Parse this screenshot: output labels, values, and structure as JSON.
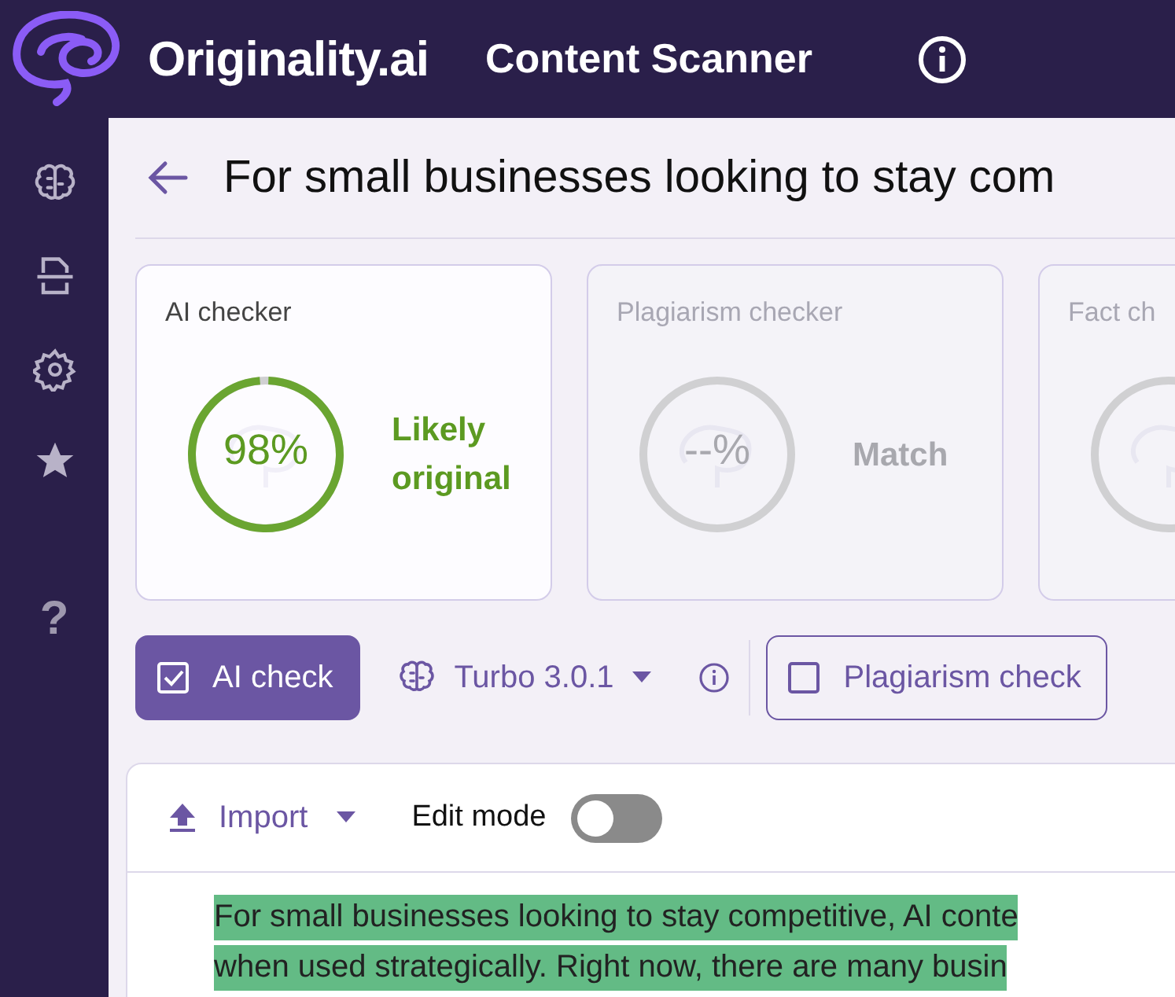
{
  "header": {
    "logo": "Originality.ai",
    "title": "Content Scanner"
  },
  "sidebar": {
    "help": "?"
  },
  "page_title": "For small businesses looking to stay com",
  "checkers": [
    {
      "title": "AI checker",
      "score": "98%",
      "verdict": "Likely original",
      "disabled": false,
      "level": 0.98
    },
    {
      "title": "Plagiarism checker",
      "score": "--%",
      "verdict": "Match",
      "disabled": true
    },
    {
      "title": "Fact ch",
      "disabled": true
    }
  ],
  "toolbar": {
    "ai_check": {
      "label": "AI check",
      "checked": true
    },
    "model": {
      "label": "Turbo 3.0.1"
    },
    "plagiarism_check": {
      "label": "Plagiarism check",
      "checked": false
    }
  },
  "editor": {
    "import": "Import",
    "edit_mode": {
      "label": "Edit mode",
      "on": false
    },
    "lines": [
      {
        "text": "For small businesses looking to stay competitive, AI conte",
        "highlighted": true
      },
      {
        "text": "when used strategically.  Right now, there are many busin",
        "highlighted": true
      }
    ]
  }
}
